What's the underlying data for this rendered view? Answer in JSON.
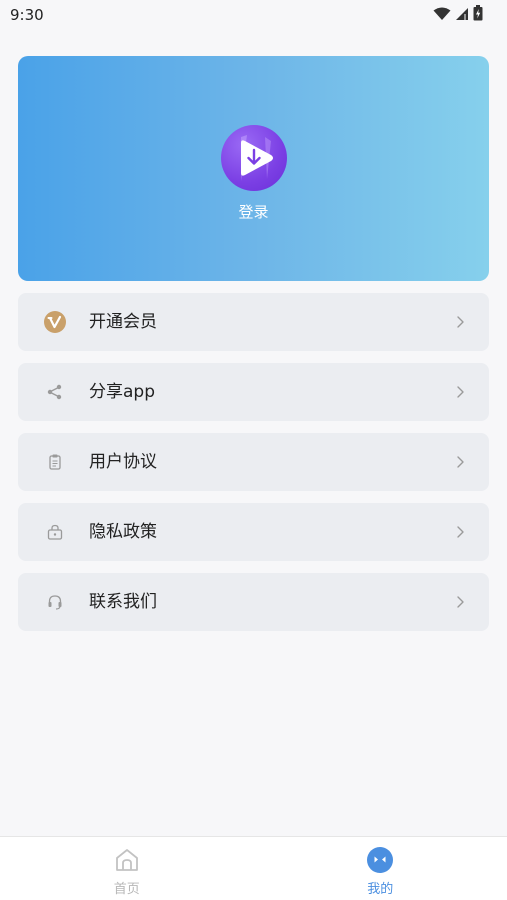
{
  "status_bar": {
    "time": "9:30",
    "icons": [
      "wifi-icon",
      "signal-icon",
      "battery-icon"
    ]
  },
  "profile": {
    "login_label": "登录",
    "logo_icon": "play-download-icon",
    "gradient_colors": [
      "#4aa2e8",
      "#86d0ec"
    ]
  },
  "menu": {
    "items": [
      {
        "label": "开通会员",
        "icon": "vip-icon"
      },
      {
        "label": "分享app",
        "icon": "share-icon"
      },
      {
        "label": "用户协议",
        "icon": "clipboard-icon"
      },
      {
        "label": "隐私政策",
        "icon": "lock-icon"
      },
      {
        "label": "联系我们",
        "icon": "headset-icon"
      }
    ]
  },
  "tabbar": {
    "tabs": [
      {
        "label": "首页",
        "icon": "home-icon",
        "active": false
      },
      {
        "label": "我的",
        "icon": "mine-icon",
        "active": true
      }
    ],
    "active_color": "#4b8fe0",
    "inactive_color": "#b7b7b7"
  }
}
